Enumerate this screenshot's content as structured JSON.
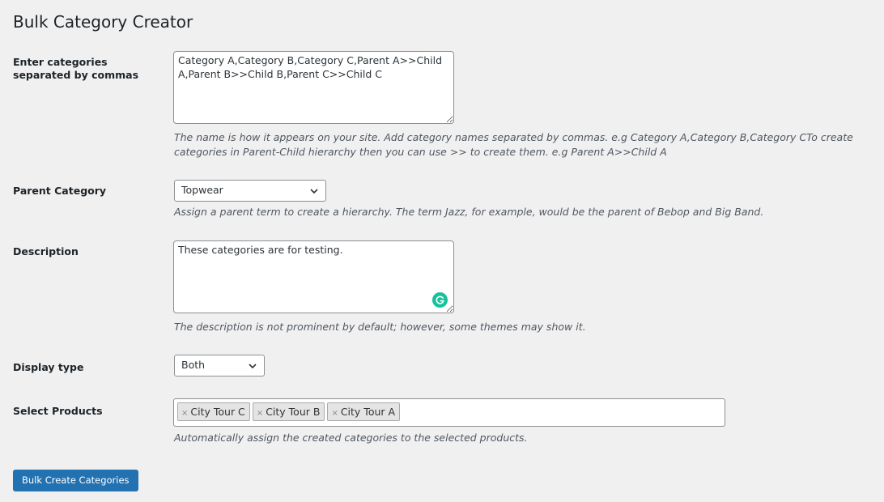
{
  "page": {
    "title": "Bulk Category Creator"
  },
  "categories_field": {
    "label": "Enter categories separated by commas",
    "value": "Category A,Category B,Category C,Parent A>>Child A,Parent B>>Child B,Parent C>>Child C",
    "help": "The name is how it appears on your site. Add category names separated by commas. e.g Category A,Category B,Category CTo create categories in Parent-Child hierarchy then you can use >> to create them. e.g Parent A>>Child A"
  },
  "parent_category": {
    "label": "Parent Category",
    "selected": "Topwear",
    "help": "Assign a parent term to create a hierarchy. The term Jazz, for example, would be the parent of Bebop and Big Band."
  },
  "description_field": {
    "label": "Description",
    "value": "These categories are for testing.",
    "help": "The description is not prominent by default; however, some themes may show it.",
    "extension_icon": "grammarly-icon"
  },
  "display_type": {
    "label": "Display type",
    "selected": "Both"
  },
  "select_products": {
    "label": "Select Products",
    "remove_glyph": "×",
    "tags": [
      {
        "label": "City Tour C"
      },
      {
        "label": "City Tour B"
      },
      {
        "label": "City Tour A"
      }
    ],
    "help": "Automatically assign the created categories to the selected products."
  },
  "submit": {
    "label": "Bulk Create Categories"
  },
  "colors": {
    "background": "#f0f0f1",
    "primary_button": "#2271b1",
    "grammarly": "#15c39a",
    "border": "#8c8f94"
  }
}
